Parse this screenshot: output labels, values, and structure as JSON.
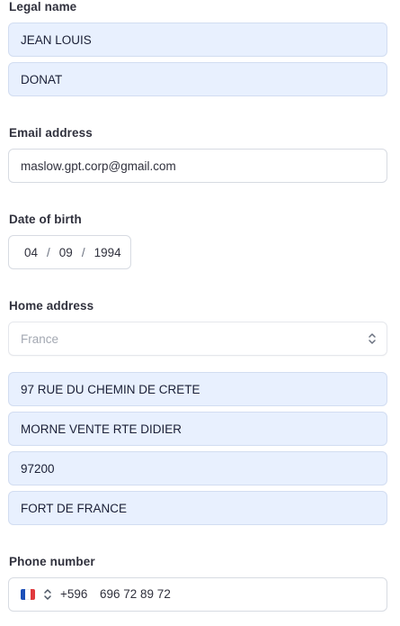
{
  "legal_name": {
    "label": "Legal name",
    "first_name": "JEAN LOUIS",
    "last_name": "DONAT"
  },
  "email": {
    "label": "Email address",
    "value": "maslow.gpt.corp@gmail.com"
  },
  "dob": {
    "label": "Date of birth",
    "day": "04",
    "month": "09",
    "year": "1994",
    "separator": "/"
  },
  "home_address": {
    "label": "Home address",
    "country_placeholder": "France",
    "line1": "97 RUE DU CHEMIN DE CRETE",
    "line2": "MORNE VENTE RTE DIDIER",
    "postal_code": "97200",
    "city": "FORT DE FRANCE"
  },
  "phone": {
    "label": "Phone number",
    "country_code": "+596",
    "number": "696 72 89 72",
    "flag": "flag-france-icon"
  },
  "colors": {
    "autofill_bg": "#e8f0fe",
    "border": "#d7dbe2",
    "label": "#30313d",
    "placeholder": "#a3a8b2",
    "flag_blue": "#1d4fb8",
    "flag_white": "#ffffff",
    "flag_red": "#e03a3e"
  }
}
